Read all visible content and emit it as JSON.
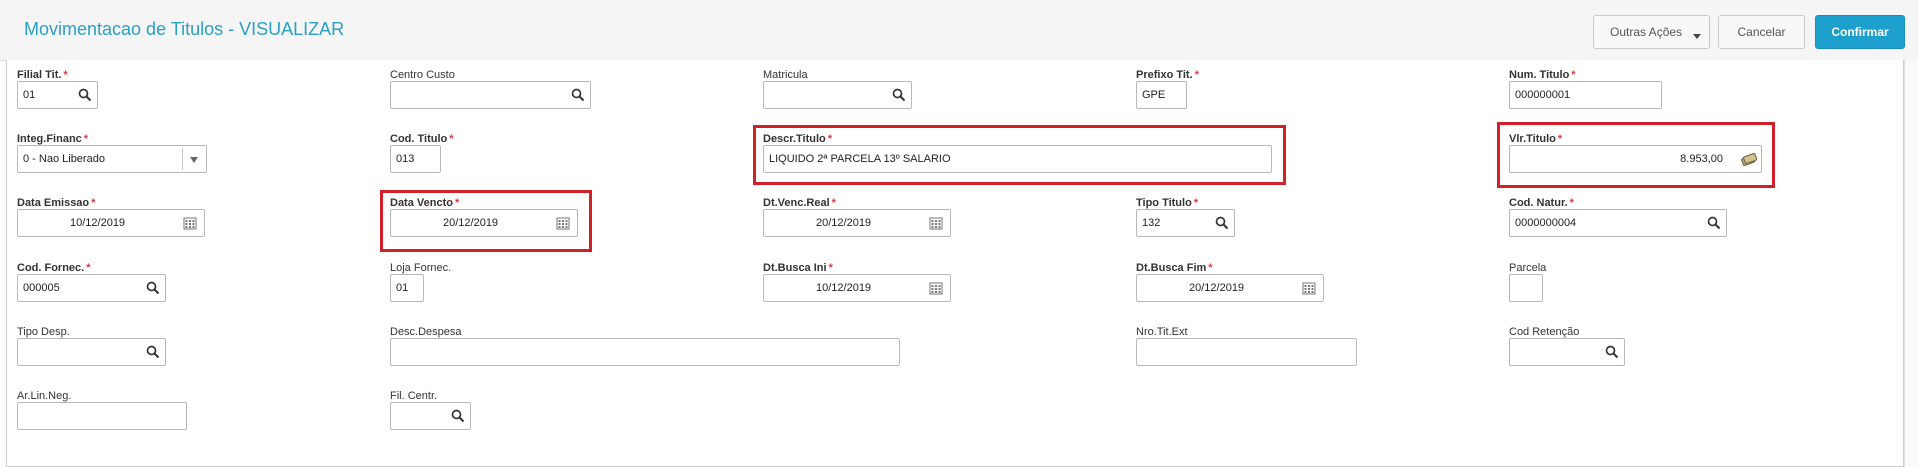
{
  "header": {
    "title": "Movimentacao de Titulos - VISUALIZAR",
    "buttons": {
      "outras": "Outras Ações",
      "cancelar": "Cancelar",
      "confirmar": "Confirmar"
    }
  },
  "fields": {
    "filial": {
      "label": "Filial Tit.",
      "required": "*",
      "value": "01"
    },
    "centro": {
      "label": "Centro Custo",
      "value": ""
    },
    "matricula": {
      "label": "Matricula",
      "value": ""
    },
    "prefixo": {
      "label": "Prefixo Tit.",
      "required": "*",
      "value": "GPE"
    },
    "numtitulo": {
      "label": "Num. Titulo",
      "required": "*",
      "value": "000000001"
    },
    "integ": {
      "label": "Integ.Financ",
      "required": "*",
      "value": "0 - Nao Liberado"
    },
    "codtitulo": {
      "label": "Cod. Titulo",
      "required": "*",
      "value": "013"
    },
    "descr": {
      "label": "Descr.Titulo",
      "required": "*",
      "value": "LIQUIDO 2ª PARCELA 13º SALARIO"
    },
    "vlr": {
      "label": "Vlr.Titulo",
      "required": "*",
      "value": "8.953,00"
    },
    "emissao": {
      "label": "Data Emissao",
      "required": "*",
      "value": "10/12/2019"
    },
    "vencto": {
      "label": "Data Vencto",
      "required": "*",
      "value": "20/12/2019"
    },
    "vencreal": {
      "label": "Dt.Venc.Real",
      "required": "*",
      "value": "20/12/2019"
    },
    "tipo": {
      "label": "Tipo Titulo",
      "required": "*",
      "value": "132"
    },
    "natur": {
      "label": "Cod. Natur.",
      "required": "*",
      "value": "0000000004"
    },
    "fornec": {
      "label": "Cod. Fornec.",
      "required": "*",
      "value": "000005"
    },
    "loja": {
      "label": "Loja Fornec.",
      "value": "01"
    },
    "buscaini": {
      "label": "Dt.Busca Ini",
      "required": "*",
      "value": "10/12/2019"
    },
    "buscafim": {
      "label": "Dt.Busca Fim",
      "required": "*",
      "value": "20/12/2019"
    },
    "parcela": {
      "label": "Parcela",
      "value": ""
    },
    "tipodesp": {
      "label": "Tipo Desp.",
      "value": ""
    },
    "descdesp": {
      "label": "Desc.Despesa",
      "value": ""
    },
    "nrotit": {
      "label": "Nro.Tit.Ext",
      "value": ""
    },
    "retencao": {
      "label": "Cod Retenção",
      "value": ""
    },
    "arlin": {
      "label": "Ar.Lin.Neg.",
      "value": ""
    },
    "filcentr": {
      "label": "Fil. Centr.",
      "value": ""
    }
  },
  "icons": {
    "search": "search-icon",
    "calendar": "calendar-icon",
    "money": "money-icon",
    "dropdown": "chevron-down-icon"
  },
  "colors": {
    "title": "#2aa0c4",
    "primary": "#1da0ce",
    "required": "#e03a3a",
    "highlight": "#d0202a"
  }
}
